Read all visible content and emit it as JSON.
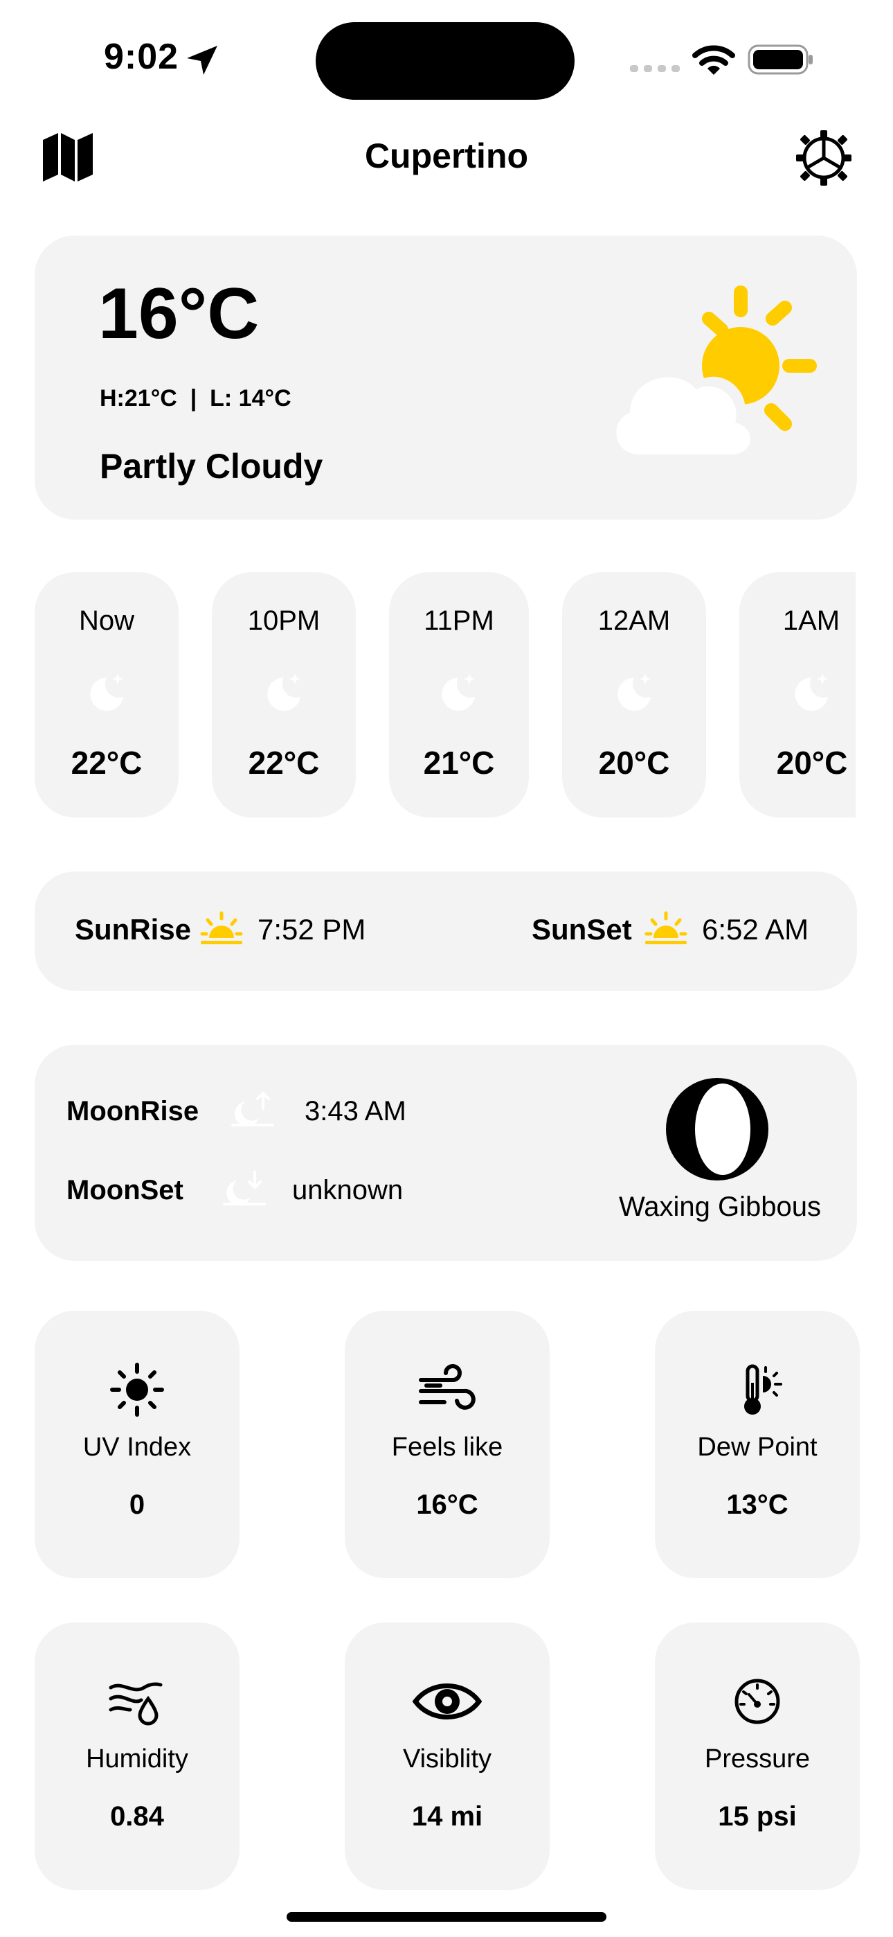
{
  "status_bar": {
    "time": "9:02"
  },
  "header": {
    "title": "Cupertino"
  },
  "current": {
    "temperature": "16°C",
    "high_low": "H:21°C  |  L: 14°C",
    "condition": "Partly Cloudy",
    "icon": "partly-cloudy-icon"
  },
  "hourly": [
    {
      "label": "Now",
      "temp": "22°C",
      "icon": "moon-stars-icon"
    },
    {
      "label": "10PM",
      "temp": "22°C",
      "icon": "moon-stars-icon"
    },
    {
      "label": "11PM",
      "temp": "21°C",
      "icon": "moon-stars-icon"
    },
    {
      "label": "12AM",
      "temp": "20°C",
      "icon": "moon-stars-icon"
    },
    {
      "label": "1AM",
      "temp": "20°C",
      "icon": "moon-stars-icon"
    }
  ],
  "sun": {
    "rise_label": "SunRise",
    "rise_time": "7:52 PM",
    "set_label": "SunSet",
    "set_time": "6:52 AM"
  },
  "moon": {
    "rise_label": "MoonRise",
    "rise_time": "3:43 AM",
    "set_label": "MoonSet",
    "set_time": "unknown",
    "phase": "Waxing Gibbous"
  },
  "metrics": [
    {
      "label": "UV Index",
      "value": "0",
      "icon": "sun-icon"
    },
    {
      "label": "Feels like",
      "value": "16°C",
      "icon": "wind-icon"
    },
    {
      "label": "Dew Point",
      "value": "13°C",
      "icon": "thermometer-sun-icon"
    },
    {
      "label": "Humidity",
      "value": "0.84",
      "icon": "humidity-icon"
    },
    {
      "label": "Visiblity",
      "value": "14 mi",
      "icon": "eye-icon"
    },
    {
      "label": "Pressure",
      "value": "15 psi",
      "icon": "gauge-icon"
    }
  ],
  "colors": {
    "accent_sun": "#FFCC00",
    "card": "#F3F3F3"
  }
}
